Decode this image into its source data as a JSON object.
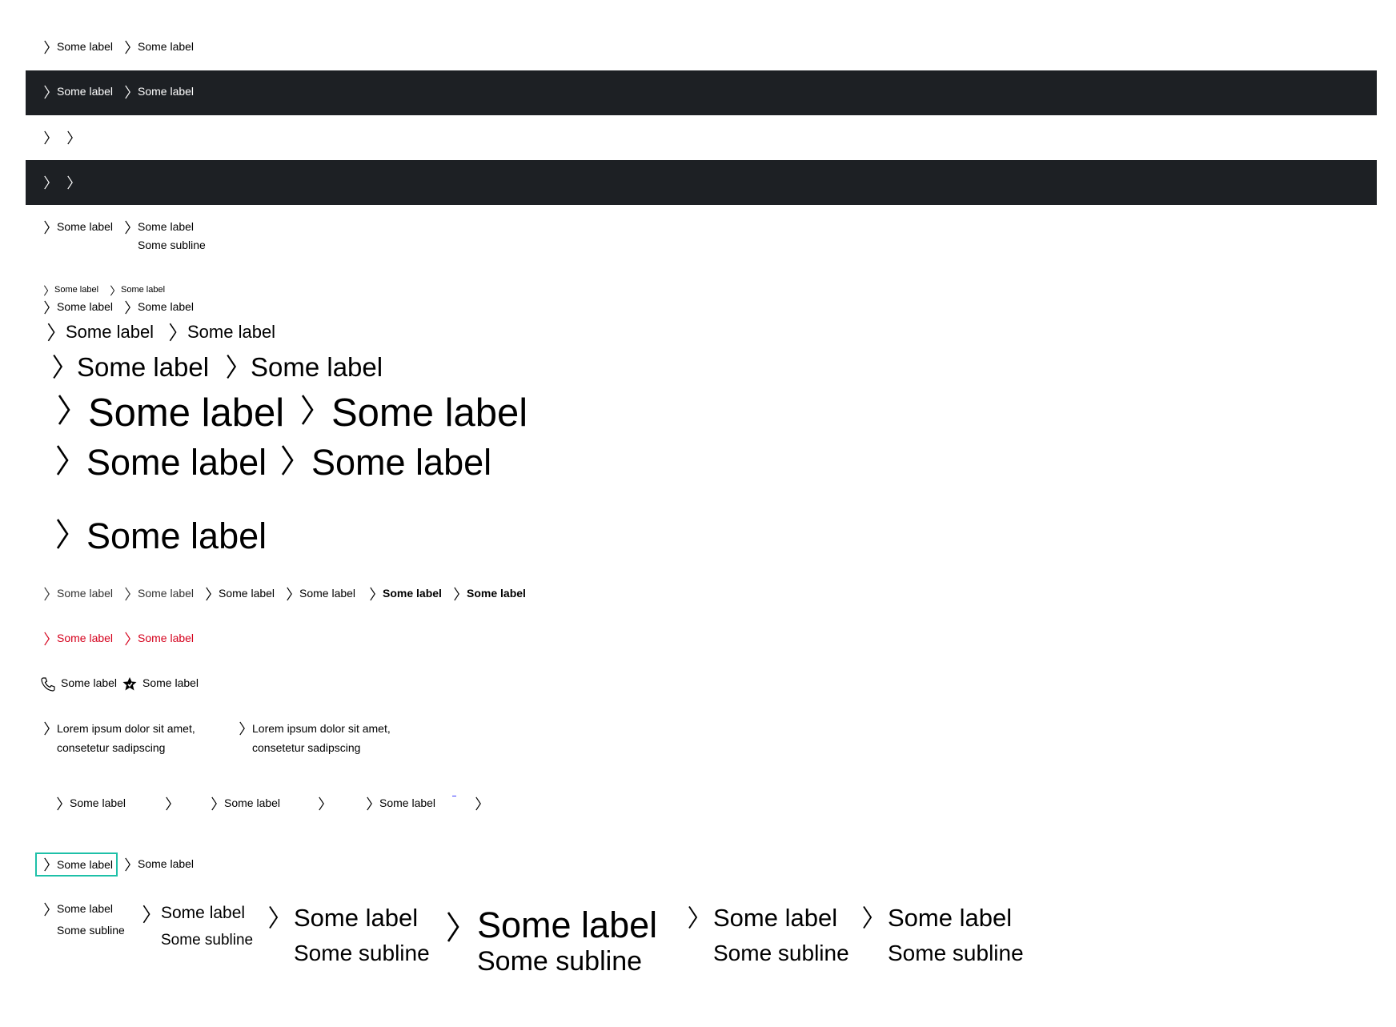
{
  "colors": {
    "dark_background": "#1d2024",
    "red": "#d5001c",
    "focus": "#1ec0a8",
    "text": "#000000",
    "white": "#ffffff"
  },
  "label": "Some label",
  "subline": "Some subline",
  "lorem": "Lorem ipsum dolor sit amet, consetetur sadipscing",
  "icons": [
    "arrow-head-right-icon",
    "phone-icon",
    "star-badge-icon"
  ]
}
